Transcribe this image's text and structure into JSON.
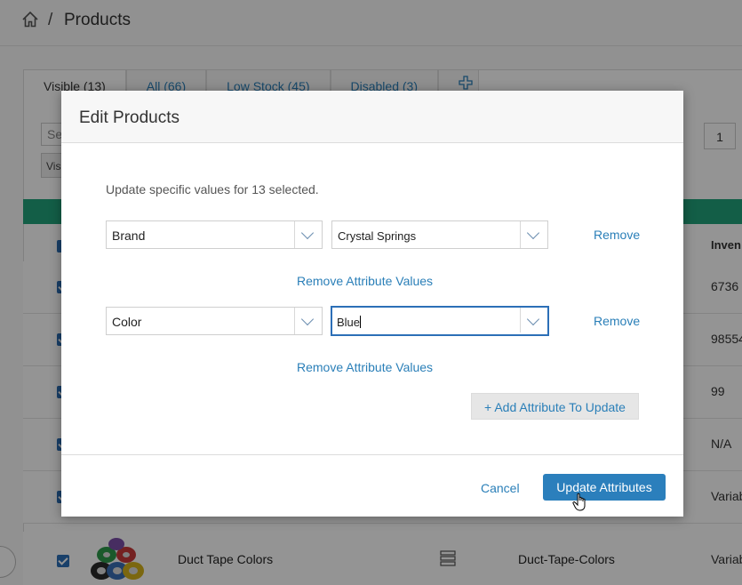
{
  "breadcrumb": {
    "separator": "/",
    "title": "Products"
  },
  "tabs": [
    {
      "label": "Visible (13)"
    },
    {
      "label": "All (66)"
    },
    {
      "label": "Low Stock (45)"
    },
    {
      "label": "Disabled (3)"
    }
  ],
  "toolbar": {
    "search_fragment": "Se",
    "visible_fragment": "Visi",
    "page_number": "1"
  },
  "table": {
    "inventory_header": "Inven",
    "inventory_values": [
      "6736",
      "98554",
      "99",
      "N/A",
      "Variab"
    ],
    "last_row": {
      "name": "Duct Tape Colors",
      "slug": "Duct-Tape-Colors",
      "inventory": "Variab"
    }
  },
  "modal": {
    "title": "Edit Products",
    "intro": "Update specific values for 13 selected.",
    "rows": [
      {
        "attribute": "Brand",
        "value": "Crystal Springs",
        "remove_label": "Remove",
        "remove_values_label": "Remove Attribute Values"
      },
      {
        "attribute": "Color",
        "value": "Blue",
        "remove_label": "Remove",
        "remove_values_label": "Remove Attribute Values"
      }
    ],
    "add_attribute_label": "+ Add Attribute To Update",
    "cancel_label": "Cancel",
    "submit_label": "Update Attributes"
  },
  "colors": {
    "accent": "#2b7fbc",
    "link": "#2a7fb8",
    "band": "#21a27a"
  }
}
